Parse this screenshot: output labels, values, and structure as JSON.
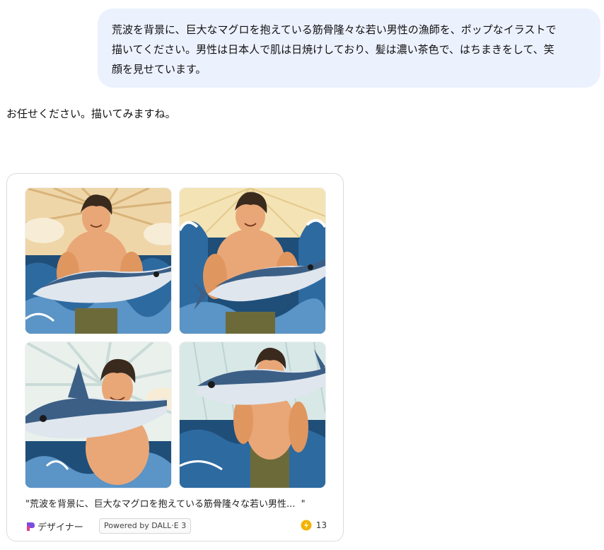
{
  "user_message": {
    "lines": [
      "荒波を背景に、巨大なマグロを抱えている筋骨隆々な若い男性の漁師を、ポップなイラストで",
      "描いてください。男性は日本人で肌は日焼けしており、髪は濃い茶色で、はちまきをして、笑",
      "顔を見せています。"
    ]
  },
  "assistant_message": {
    "text": "お任せください。描いてみますね。"
  },
  "image_card": {
    "images": [
      {
        "icon": "fisherman-tuna-image-1"
      },
      {
        "icon": "fisherman-tuna-image-2"
      },
      {
        "icon": "fisherman-tuna-image-3"
      },
      {
        "icon": "fisherman-tuna-image-4"
      }
    ],
    "caption": "\"荒波を背景に、巨大なマグロを抱えている筋骨隆々な若い男性...  \"",
    "designer_label": "デザイナー",
    "powered_by": "Powered by DALL·E 3",
    "boost_count": "13"
  },
  "colors": {
    "user_bubble": "#ecf1fe",
    "card_border": "#dcdcdc",
    "skin": "#e9a777",
    "hair": "#3a2a1e",
    "ocean": "#1f4e79",
    "tuna": "#3c5f86",
    "boost": "#f2b300"
  }
}
